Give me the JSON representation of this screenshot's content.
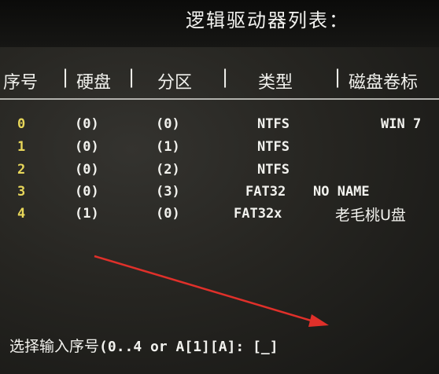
{
  "title": "逻辑驱动器列表：",
  "columns": [
    "序号",
    "硬盘",
    "分区",
    "类型",
    "磁盘卷标"
  ],
  "rows": [
    {
      "index": "0",
      "disk": "(0)",
      "partition": "(0)",
      "type": "NTFS",
      "label": "WIN 7"
    },
    {
      "index": "1",
      "disk": "(0)",
      "partition": "(1)",
      "type": "NTFS",
      "label": ""
    },
    {
      "index": "2",
      "disk": "(0)",
      "partition": "(2)",
      "type": "NTFS",
      "label": ""
    },
    {
      "index": "3",
      "disk": "(0)",
      "partition": "(3)",
      "type": "FAT32",
      "label": "NO NAME"
    },
    {
      "index": "4",
      "disk": "(1)",
      "partition": "(0)",
      "type": "FAT32x",
      "label": "老毛桃U盘"
    }
  ],
  "prompt": {
    "label": "选择输入序号",
    "range": "(0..4 or A[1][A]:",
    "input_value": "[_]"
  },
  "colors": {
    "index_digits": "#e8d75a",
    "text": "#f2f2ee",
    "arrow": "#e0302a"
  }
}
